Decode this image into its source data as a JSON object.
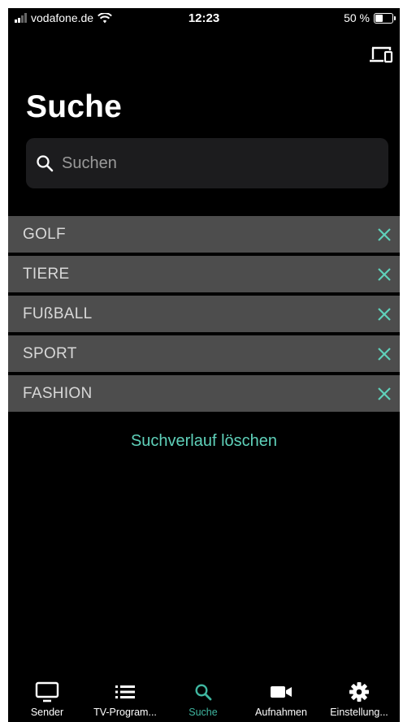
{
  "status_bar": {
    "carrier": "vodafone.de",
    "time": "12:23",
    "battery": "50 %",
    "battery_level": 0.5
  },
  "page": {
    "title": "Suche"
  },
  "search": {
    "placeholder": "Suchen",
    "value": ""
  },
  "history": [
    {
      "label": "GOLF"
    },
    {
      "label": "TIERE"
    },
    {
      "label": "FUßBALL"
    },
    {
      "label": "SPORT"
    },
    {
      "label": "FASHION"
    }
  ],
  "clear_history_label": "Suchverlauf löschen",
  "tabs": [
    {
      "label": "Sender",
      "icon": "tv-icon"
    },
    {
      "label": "TV-Program...",
      "icon": "list-icon"
    },
    {
      "label": "Suche",
      "icon": "search-icon",
      "active": true
    },
    {
      "label": "Aufnahmen",
      "icon": "camera-icon"
    },
    {
      "label": "Einstellung...",
      "icon": "gear-icon"
    }
  ],
  "colors": {
    "background": "#000000",
    "accent": "#5fd1ba",
    "list_item": "#4d4d4d",
    "search_field": "#1c1c1e"
  }
}
